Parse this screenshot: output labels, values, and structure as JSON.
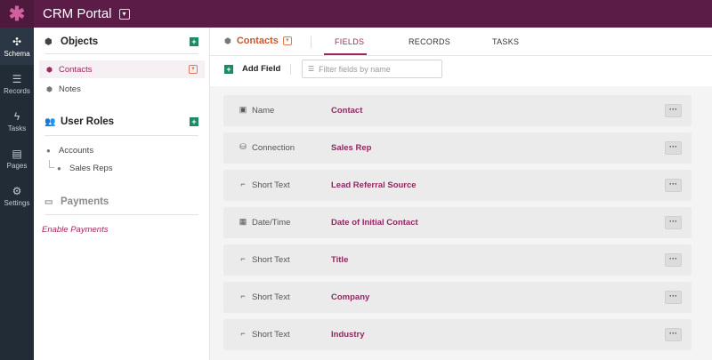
{
  "app": {
    "title": "CRM Portal",
    "logo_icon": "asterisk-icon"
  },
  "rail": [
    {
      "label": "Schema",
      "icon": "schema-icon",
      "glyph": "⚙",
      "active": true
    },
    {
      "label": "Records",
      "icon": "database-icon",
      "glyph": "≡",
      "active": false
    },
    {
      "label": "Tasks",
      "icon": "lightning-icon",
      "glyph": "⚡",
      "active": false
    },
    {
      "label": "Pages",
      "icon": "pages-icon",
      "glyph": "▤",
      "active": false
    },
    {
      "label": "Settings",
      "icon": "gear-icon",
      "glyph": "⚙",
      "active": false
    }
  ],
  "sidebar": {
    "objects_title": "Objects",
    "objects": [
      {
        "label": "Contacts",
        "active": true
      },
      {
        "label": "Notes",
        "active": false
      }
    ],
    "roles_title": "User Roles",
    "roles": [
      {
        "label": "Accounts"
      },
      {
        "label": "Sales Reps"
      }
    ],
    "payments_title": "Payments",
    "enable_payments": "Enable Payments"
  },
  "main": {
    "object_title": "Contacts",
    "tabs": [
      "FIELDS",
      "RECORDS",
      "TASKS"
    ],
    "active_tab": "FIELDS",
    "add_field_label": "Add Field",
    "search_placeholder": "Filter fields by name"
  },
  "fields": [
    {
      "type": "Name",
      "name": "Contact",
      "icon": "id-card-icon"
    },
    {
      "type": "Connection",
      "name": "Sales Rep",
      "icon": "connection-icon"
    },
    {
      "type": "Short Text",
      "name": "Lead Referral Source",
      "icon": "short-text-icon"
    },
    {
      "type": "Date/Time",
      "name": "Date of Initial Contact",
      "icon": "calendar-icon"
    },
    {
      "type": "Short Text",
      "name": "Title",
      "icon": "short-text-icon"
    },
    {
      "type": "Short Text",
      "name": "Company",
      "icon": "short-text-icon"
    },
    {
      "type": "Short Text",
      "name": "Industry",
      "icon": "short-text-icon"
    }
  ],
  "colors": {
    "topbar": "#5b1d47",
    "accent": "#a0285f",
    "object_accent": "#c7572f",
    "add_green": "#1d8a63",
    "rail_bg": "#222c36"
  }
}
